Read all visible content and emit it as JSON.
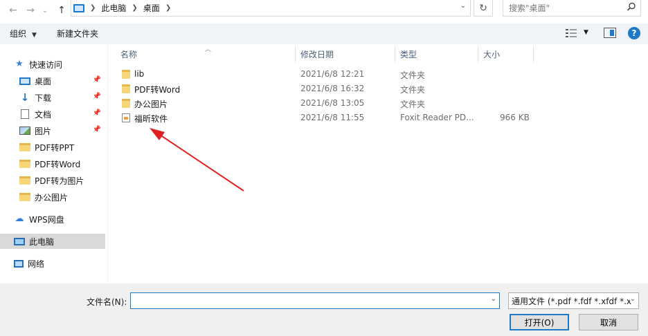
{
  "address": {
    "back_glyph": "←",
    "forward_glyph": "→",
    "recent_glyph": "⌄",
    "up_glyph": "↑",
    "crumbs": [
      "此电脑",
      "桌面"
    ],
    "search_placeholder": "搜索\"桌面\""
  },
  "toolbar": {
    "organize_label": "组织",
    "new_folder_label": "新建文件夹",
    "help_label": "?"
  },
  "sidebar": {
    "items": [
      {
        "label": "快速访问",
        "icon": "star-icon"
      },
      {
        "label": "桌面",
        "icon": "desktop-icon",
        "pinned": true
      },
      {
        "label": "下载",
        "icon": "download-icon",
        "pinned": true
      },
      {
        "label": "文档",
        "icon": "document-icon",
        "pinned": true
      },
      {
        "label": "图片",
        "icon": "picture-icon",
        "pinned": true
      },
      {
        "label": "PDF转PPT",
        "icon": "folder-icon"
      },
      {
        "label": "PDF转Word",
        "icon": "folder-icon"
      },
      {
        "label": "PDF转为图片",
        "icon": "folder-icon"
      },
      {
        "label": "办公图片",
        "icon": "folder-icon"
      },
      {
        "label": "WPS网盘",
        "icon": "cloud-icon"
      },
      {
        "label": "此电脑",
        "icon": "computer-icon",
        "selected": true
      },
      {
        "label": "网络",
        "icon": "network-icon"
      }
    ]
  },
  "list": {
    "columns": [
      "名称",
      "修改日期",
      "类型",
      "大小"
    ],
    "rows": [
      {
        "name": "lib",
        "date": "2021/6/8 12:21",
        "type": "文件夹",
        "size": "",
        "icon": "folder-icon"
      },
      {
        "name": "PDF转Word",
        "date": "2021/6/8 16:32",
        "type": "文件夹",
        "size": "",
        "icon": "folder-icon"
      },
      {
        "name": "办公图片",
        "date": "2021/6/8 13:05",
        "type": "文件夹",
        "size": "",
        "icon": "folder-icon"
      },
      {
        "name": "福昕软件",
        "date": "2021/6/8 11:55",
        "type": "Foxit Reader PD...",
        "size": "966 KB",
        "icon": "pdf-file-icon"
      }
    ]
  },
  "bottom": {
    "filename_label": "文件名(N):",
    "filename_value": "",
    "filetype_value": "通用文件 (*.pdf *.fdf *.xfdf *.x",
    "open_label": "打开(O)",
    "cancel_label": "取消"
  },
  "colors": {
    "accent": "#1e78c8",
    "arrow": "#e02020",
    "toolbar_bg": "#f0f3f7",
    "selected_bg": "#d9d9d9"
  }
}
